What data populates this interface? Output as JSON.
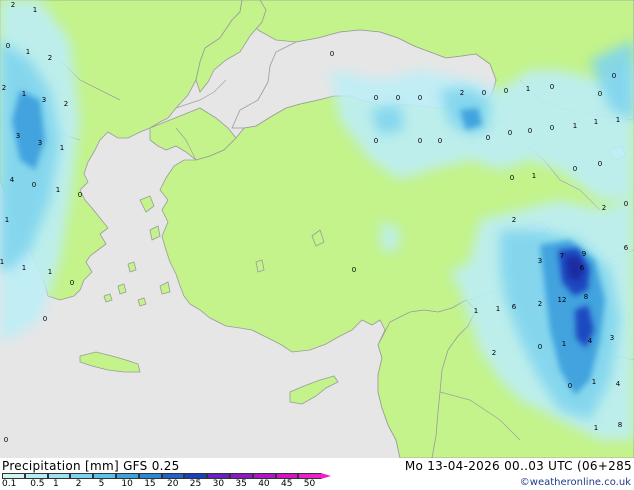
{
  "map": {
    "sea_color": "#e6e6e6",
    "land_color": "#c3f38a",
    "coast_color": "#9a9a9a",
    "value_labels": [
      "2",
      "1",
      "0",
      "1",
      "2",
      "2",
      "1",
      "3",
      "2",
      "3",
      "3",
      "1",
      "4",
      "0",
      "1",
      "0",
      "1",
      "1",
      "1",
      "1",
      "0",
      "0",
      "0",
      "0",
      "0",
      "0",
      "2",
      "0",
      "0",
      "1",
      "0",
      "0",
      "0",
      "0",
      "0",
      "0",
      "0",
      "0",
      "0",
      "0",
      "1",
      "1",
      "1",
      "0",
      "0",
      "0",
      "1",
      "2",
      "0",
      "2",
      "3",
      "7",
      "9",
      "6",
      "8",
      "6",
      "12",
      "2",
      "1",
      "1",
      "6",
      "1",
      "0",
      "4",
      "3",
      "2",
      "0",
      "1",
      "4",
      "1",
      "8",
      "0",
      "0"
    ]
  },
  "legend": {
    "title": "Precipitation [mm]  GFS 0.25",
    "run": "Mo 13-04-2026 00..03 UTC (06+285",
    "credit": "©weatheronline.co.uk",
    "ticks": [
      "0.1",
      "0.5",
      "1",
      "2",
      "5",
      "10",
      "15",
      "20",
      "25",
      "30",
      "35",
      "40",
      "45",
      "50"
    ],
    "colors": [
      "#cff4f8",
      "#b6ecf6",
      "#9ce2f3",
      "#7cd5ee",
      "#5ac3e8",
      "#3aa5dd",
      "#2a86d6",
      "#2162cc",
      "#1a3ec0",
      "#6a1fc6",
      "#8e18c8",
      "#b414c8",
      "#d612c6",
      "#ee20cc"
    ]
  }
}
